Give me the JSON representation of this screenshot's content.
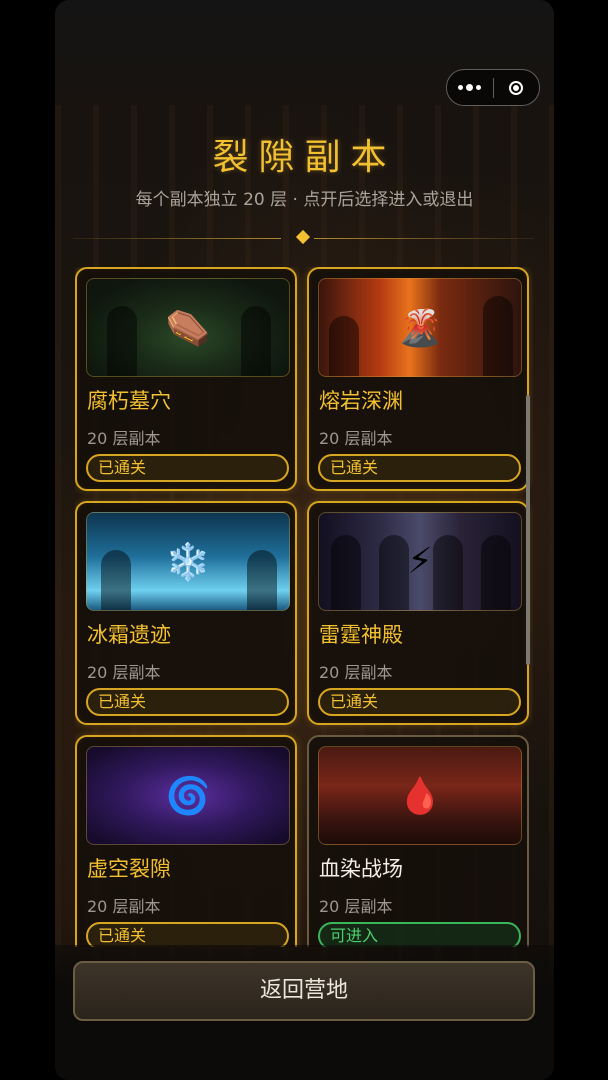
{
  "header": {
    "title": "裂隙副本",
    "subtitle": "每个副本独立 20 层 · 点开后选择进入或退出"
  },
  "miniprogram_capsule": {
    "more_icon": "more-dots-icon",
    "close_icon": "target-circle-icon"
  },
  "dungeons": [
    {
      "name": "腐朽墓穴",
      "sub": "20 层副本",
      "status": "已通关",
      "icon": "coffin-icon",
      "glyph": "⚰️"
    },
    {
      "name": "熔岩深渊",
      "sub": "20 层副本",
      "status": "已通关",
      "icon": "volcano-icon",
      "glyph": "🌋"
    },
    {
      "name": "冰霜遗迹",
      "sub": "20 层副本",
      "status": "已通关",
      "icon": "snowflake-icon",
      "glyph": "❄️"
    },
    {
      "name": "雷霆神殿",
      "sub": "20 层副本",
      "status": "已通关",
      "icon": "lightning-icon",
      "glyph": "⚡"
    },
    {
      "name": "虚空裂隙",
      "sub": "20 层副本",
      "status": "已通关",
      "icon": "swirl-icon",
      "glyph": "🌀"
    },
    {
      "name": "血染战场",
      "sub": "20 层副本",
      "status": "可进入",
      "icon": "blood-drop-icon",
      "glyph": "🩸"
    }
  ],
  "footer": {
    "back_label": "返回营地"
  },
  "colors": {
    "gold": "#f2c030",
    "card_border": "#d8a520",
    "enter_green": "#4ccf6c"
  }
}
